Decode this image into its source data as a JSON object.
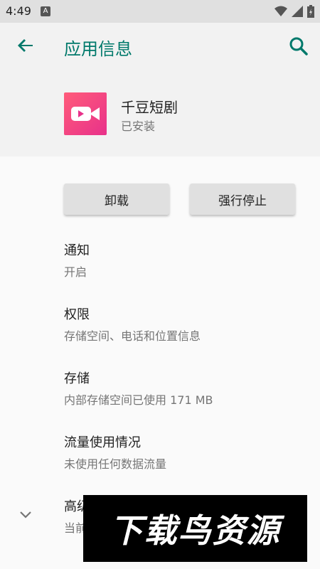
{
  "status_bar": {
    "time": "4:49",
    "notification_icon": "A"
  },
  "header": {
    "title": "应用信息",
    "back_icon": "arrow-back-icon",
    "search_icon": "search-icon"
  },
  "app": {
    "name": "千豆短剧",
    "status": "已安装"
  },
  "actions": {
    "uninstall": "卸载",
    "force_stop": "强行停止"
  },
  "items": [
    {
      "title": "通知",
      "subtitle": "开启"
    },
    {
      "title": "权限",
      "subtitle": "存储空间、电话和位置信息"
    },
    {
      "title": "存储",
      "subtitle": "内部存储空间已使用 171 MB"
    },
    {
      "title": "流量使用情况",
      "subtitle": "未使用任何数据流量"
    },
    {
      "title": "高级",
      "subtitle": "当前"
    }
  ],
  "watermark": "下载鸟资源",
  "colors": {
    "accent": "#00796b",
    "icon_gradient_start": "#ff5c7a",
    "icon_gradient_end": "#e8318a"
  }
}
